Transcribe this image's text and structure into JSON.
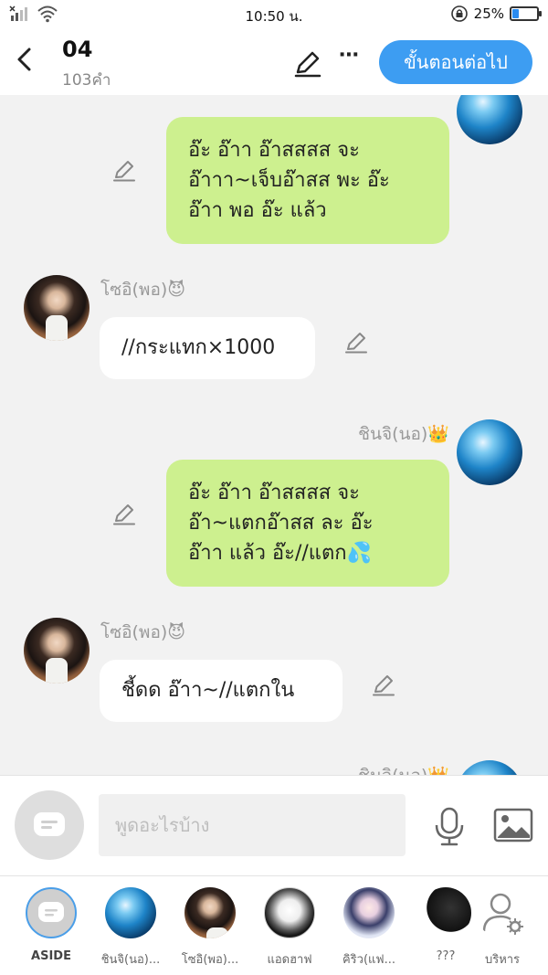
{
  "status_bar": {
    "time": "10:50 น.",
    "battery": "25%",
    "battery_level": 0.25
  },
  "header": {
    "title": "04",
    "subtitle": "103คำ",
    "next_button": "ขั้นตอนต่อไป",
    "more": "⋯"
  },
  "messages": [
    {
      "side": "right",
      "speaker": "",
      "text_lines": [
        "อ๊ะ อ๊าา อ๊าสสสส จะ",
        "อ๊าาา~เจ็บอ๊าสส พะ อ๊ะ",
        "อ๊าา พอ อ๊ะ แล้ว"
      ]
    },
    {
      "side": "left",
      "speaker": "โซอิ(พอ)😈",
      "text_lines": [
        "//กระแทก×1000"
      ]
    },
    {
      "side": "right",
      "speaker": "ชินจิ(นอ)👑",
      "text_lines": [
        "อ๊ะ อ๊าา อ๊าสสสส จะ",
        "อ๊า~แตกอ๊าสส ละ อ๊ะ",
        "อ๊าา แล้ว อ๊ะ//แตก💦"
      ]
    },
    {
      "side": "left",
      "speaker": "โซอิ(พอ)😈",
      "text_lines": [
        "ชี้ดด อ๊าา~//แตกใน"
      ]
    },
    {
      "side": "right",
      "speaker": "ชินจิ(นอ)👑",
      "text_lines": []
    }
  ],
  "input": {
    "placeholder": "พูดอะไรบ้าง"
  },
  "characters": [
    {
      "label": "ASIDE",
      "avatar": "aside",
      "selected": true
    },
    {
      "label": "ชินจิ(นอ)...",
      "avatar": "blue-water"
    },
    {
      "label": "โซอิ(พอ)...",
      "avatar": "man-dark-hair"
    },
    {
      "label": "แอดฮาฟ",
      "avatar": "sketch"
    },
    {
      "label": "คิริว(แฟ...",
      "avatar": "boy-purple"
    },
    {
      "label": "???",
      "avatar": "dark-hair"
    },
    {
      "label": "บริหาร",
      "avatar": "admin-icon"
    }
  ],
  "colors": {
    "accent": "#3d9df2",
    "bubble_green": "#cdf08f",
    "bubble_white": "#ffffff",
    "background": "#f2f2f2"
  }
}
